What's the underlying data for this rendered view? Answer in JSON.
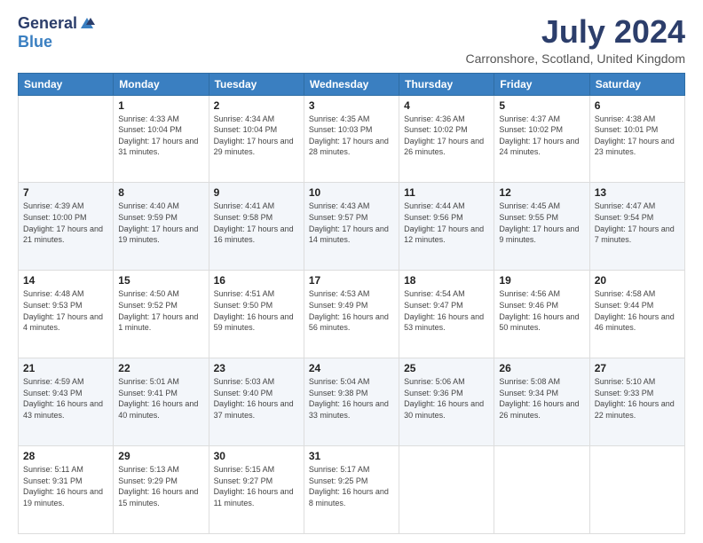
{
  "logo": {
    "general": "General",
    "blue": "Blue"
  },
  "header": {
    "month": "July 2024",
    "location": "Carronshore, Scotland, United Kingdom"
  },
  "days": [
    "Sunday",
    "Monday",
    "Tuesday",
    "Wednesday",
    "Thursday",
    "Friday",
    "Saturday"
  ],
  "weeks": [
    [
      {
        "day": "",
        "info": ""
      },
      {
        "day": "1",
        "info": "Sunrise: 4:33 AM\nSunset: 10:04 PM\nDaylight: 17 hours and 31 minutes."
      },
      {
        "day": "2",
        "info": "Sunrise: 4:34 AM\nSunset: 10:04 PM\nDaylight: 17 hours and 29 minutes."
      },
      {
        "day": "3",
        "info": "Sunrise: 4:35 AM\nSunset: 10:03 PM\nDaylight: 17 hours and 28 minutes."
      },
      {
        "day": "4",
        "info": "Sunrise: 4:36 AM\nSunset: 10:02 PM\nDaylight: 17 hours and 26 minutes."
      },
      {
        "day": "5",
        "info": "Sunrise: 4:37 AM\nSunset: 10:02 PM\nDaylight: 17 hours and 24 minutes."
      },
      {
        "day": "6",
        "info": "Sunrise: 4:38 AM\nSunset: 10:01 PM\nDaylight: 17 hours and 23 minutes."
      }
    ],
    [
      {
        "day": "7",
        "info": "Sunrise: 4:39 AM\nSunset: 10:00 PM\nDaylight: 17 hours and 21 minutes."
      },
      {
        "day": "8",
        "info": "Sunrise: 4:40 AM\nSunset: 9:59 PM\nDaylight: 17 hours and 19 minutes."
      },
      {
        "day": "9",
        "info": "Sunrise: 4:41 AM\nSunset: 9:58 PM\nDaylight: 17 hours and 16 minutes."
      },
      {
        "day": "10",
        "info": "Sunrise: 4:43 AM\nSunset: 9:57 PM\nDaylight: 17 hours and 14 minutes."
      },
      {
        "day": "11",
        "info": "Sunrise: 4:44 AM\nSunset: 9:56 PM\nDaylight: 17 hours and 12 minutes."
      },
      {
        "day": "12",
        "info": "Sunrise: 4:45 AM\nSunset: 9:55 PM\nDaylight: 17 hours and 9 minutes."
      },
      {
        "day": "13",
        "info": "Sunrise: 4:47 AM\nSunset: 9:54 PM\nDaylight: 17 hours and 7 minutes."
      }
    ],
    [
      {
        "day": "14",
        "info": "Sunrise: 4:48 AM\nSunset: 9:53 PM\nDaylight: 17 hours and 4 minutes."
      },
      {
        "day": "15",
        "info": "Sunrise: 4:50 AM\nSunset: 9:52 PM\nDaylight: 17 hours and 1 minute."
      },
      {
        "day": "16",
        "info": "Sunrise: 4:51 AM\nSunset: 9:50 PM\nDaylight: 16 hours and 59 minutes."
      },
      {
        "day": "17",
        "info": "Sunrise: 4:53 AM\nSunset: 9:49 PM\nDaylight: 16 hours and 56 minutes."
      },
      {
        "day": "18",
        "info": "Sunrise: 4:54 AM\nSunset: 9:47 PM\nDaylight: 16 hours and 53 minutes."
      },
      {
        "day": "19",
        "info": "Sunrise: 4:56 AM\nSunset: 9:46 PM\nDaylight: 16 hours and 50 minutes."
      },
      {
        "day": "20",
        "info": "Sunrise: 4:58 AM\nSunset: 9:44 PM\nDaylight: 16 hours and 46 minutes."
      }
    ],
    [
      {
        "day": "21",
        "info": "Sunrise: 4:59 AM\nSunset: 9:43 PM\nDaylight: 16 hours and 43 minutes."
      },
      {
        "day": "22",
        "info": "Sunrise: 5:01 AM\nSunset: 9:41 PM\nDaylight: 16 hours and 40 minutes."
      },
      {
        "day": "23",
        "info": "Sunrise: 5:03 AM\nSunset: 9:40 PM\nDaylight: 16 hours and 37 minutes."
      },
      {
        "day": "24",
        "info": "Sunrise: 5:04 AM\nSunset: 9:38 PM\nDaylight: 16 hours and 33 minutes."
      },
      {
        "day": "25",
        "info": "Sunrise: 5:06 AM\nSunset: 9:36 PM\nDaylight: 16 hours and 30 minutes."
      },
      {
        "day": "26",
        "info": "Sunrise: 5:08 AM\nSunset: 9:34 PM\nDaylight: 16 hours and 26 minutes."
      },
      {
        "day": "27",
        "info": "Sunrise: 5:10 AM\nSunset: 9:33 PM\nDaylight: 16 hours and 22 minutes."
      }
    ],
    [
      {
        "day": "28",
        "info": "Sunrise: 5:11 AM\nSunset: 9:31 PM\nDaylight: 16 hours and 19 minutes."
      },
      {
        "day": "29",
        "info": "Sunrise: 5:13 AM\nSunset: 9:29 PM\nDaylight: 16 hours and 15 minutes."
      },
      {
        "day": "30",
        "info": "Sunrise: 5:15 AM\nSunset: 9:27 PM\nDaylight: 16 hours and 11 minutes."
      },
      {
        "day": "31",
        "info": "Sunrise: 5:17 AM\nSunset: 9:25 PM\nDaylight: 16 hours and 8 minutes."
      },
      {
        "day": "",
        "info": ""
      },
      {
        "day": "",
        "info": ""
      },
      {
        "day": "",
        "info": ""
      }
    ]
  ]
}
